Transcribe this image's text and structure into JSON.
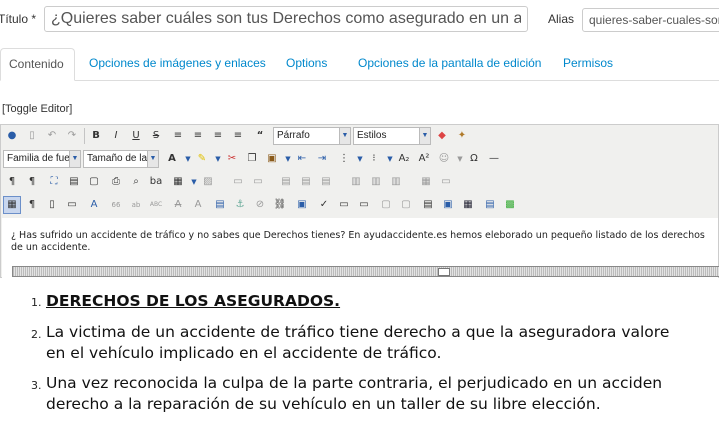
{
  "form": {
    "title_label": "Título *",
    "title_value": "¿Quieres saber cuáles son tus Derechos como asegurado en un a",
    "alias_label": "Alias",
    "alias_value": "quieres-saber-cuales-son"
  },
  "tabs": [
    {
      "label": "Contenido"
    },
    {
      "label": "Opciones de imágenes y enlaces"
    },
    {
      "label": "Options"
    },
    {
      "label": "Opciones de la pantalla de edición"
    },
    {
      "label": "Permisos"
    }
  ],
  "toggle_editor": "[Toggle Editor]",
  "toolbar": {
    "format_select": "Párrafo",
    "styles_select": "Estilos",
    "font_family_select": "Familia de fuer",
    "font_size_select": "Tamaño de la f"
  },
  "content": {
    "intro_line1": "¿ Has sufrido un accidente de tráfico y no sabes que Derechos tienes? En ayudaccidente.es hemos eleborado un pequeño listado de los derechos",
    "intro_line2": "de un accidente.",
    "list": [
      {
        "num": "1.",
        "lines": [
          "DERECHOS DE LOS ASEGURADOS."
        ]
      },
      {
        "num": "2.",
        "lines": [
          "La victima de un accidente de tráfico tiene derecho a que la aseguradora valore",
          "en el vehículo implicado en el accidente de tráfico."
        ]
      },
      {
        "num": "3.",
        "lines": [
          "Una vez reconocida la culpa de la parte contraria, el perjudicado en un acciden",
          "derecho a la reparación de su vehículo en un taller de su libre elección."
        ]
      }
    ]
  },
  "colors": {
    "link": "#0088cc",
    "toolbar_bg": "#f0f0ee",
    "active_button": "#c8d6ee"
  }
}
